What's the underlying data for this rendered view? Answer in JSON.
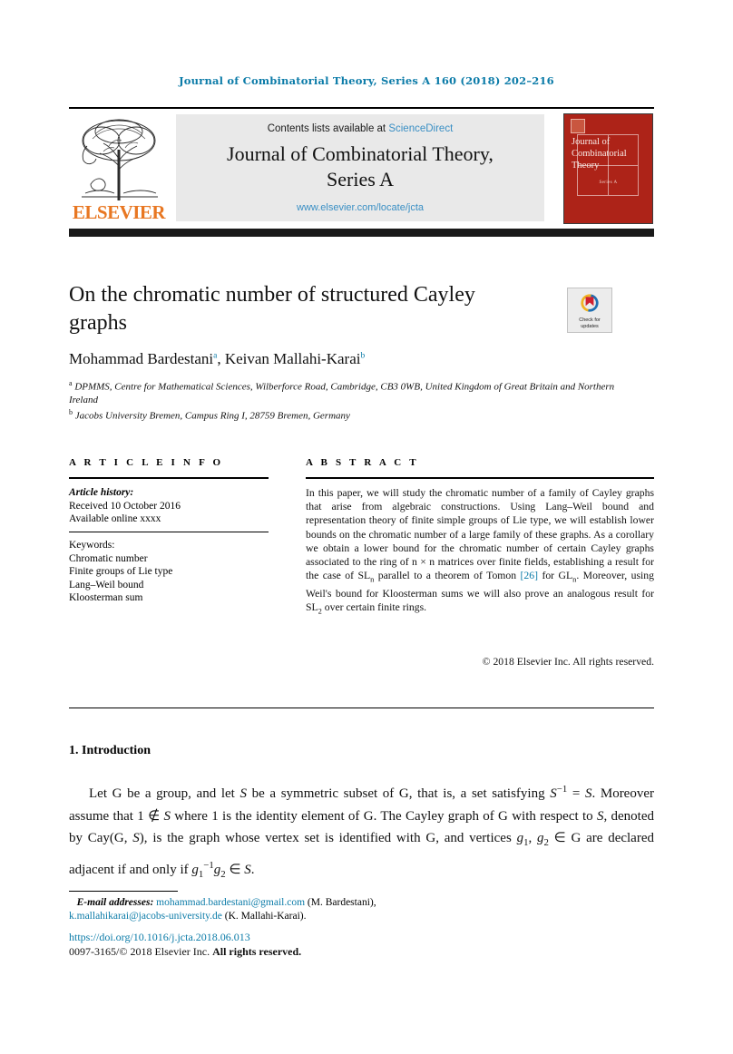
{
  "running_head": "Journal of Combinatorial Theory, Series A 160 (2018) 202–216",
  "masthead": {
    "contents_prefix": "Contents lists available at ",
    "sciencedirect": "ScienceDirect",
    "journal_title_line1": "Journal of Combinatorial Theory,",
    "journal_title_line2": "Series A",
    "journal_url": "www.elsevier.com/locate/jcta",
    "publisher_wordmark": "ELSEVIER",
    "cover": {
      "title": "Journal of Combinatorial Theory",
      "series": "Series A"
    },
    "colors": {
      "link": "#3a8fc4",
      "elsevier_orange": "#e87722",
      "cover_red": "#ad2318",
      "box_gray": "#e9e9e9"
    }
  },
  "article": {
    "title": "On the chromatic number of structured Cayley graphs",
    "authors": "Mohammad Bardestani, Keivan Mallahi-Karai",
    "author_list": [
      {
        "name": "Mohammad Bardestani",
        "marker": "a"
      },
      {
        "name": "Keivan Mallahi-Karai",
        "marker": "b"
      }
    ],
    "affiliations": [
      {
        "marker": "a",
        "text": "DPMMS, Centre for Mathematical Sciences, Wilberforce Road, Cambridge, CB3 0WB, United Kingdom of Great Britain and Northern Ireland"
      },
      {
        "marker": "b",
        "text": "Jacobs University Bremen, Campus Ring I, 28759 Bremen, Germany"
      }
    ],
    "crossmark_label_line1": "Check for",
    "crossmark_label_line2": "updates"
  },
  "info": {
    "heading": "A R T I C L E  I N F O",
    "history_label": "Article history:",
    "history": [
      "Received 10 October 2016",
      "Available online xxxx"
    ],
    "keywords_label": "Keywords:",
    "keywords": [
      "Chromatic number",
      "Finite groups of Lie type",
      "Lang–Weil bound",
      "Kloosterman sum"
    ]
  },
  "abstract": {
    "heading": "A B S T R A C T",
    "text_part1": "In this paper, we will study the chromatic number of a family of Cayley graphs that arise from algebraic constructions. Using Lang–Weil bound and representation theory of finite simple groups of Lie type, we will establish lower bounds on the chromatic number of a large family of these graphs. As a corollary we obtain a lower bound for the chromatic number of certain Cayley graphs associated to the ring of n × n matrices over finite fields, establishing a result for the case of SL",
    "sub1": "n",
    "text_part2": " parallel to a theorem of Tomon ",
    "citation": "[26]",
    "text_part3": " for GL",
    "sub2": "n",
    "text_part4": ". Moreover, using Weil's bound for Kloosterman sums we will also prove an analogous result for SL",
    "sub3": "2",
    "text_part5": " over certain finite rings.",
    "copyright": "© 2018 Elsevier Inc. All rights reserved."
  },
  "body": {
    "section_number_title": "1. Introduction",
    "paragraph_part1": "Let G be a group, and let ",
    "p_s1": "S",
    "paragraph_part2": " be a symmetric subset of G, that is, a set satisfying ",
    "p_s2": "S",
    "p_sup1": "−1",
    "paragraph_part3": " = ",
    "p_s3": "S",
    "paragraph_part4": ". Moreover assume that 1 ∉ ",
    "p_s4": "S",
    "paragraph_part5": " where 1 is the identity element of G. The Cayley graph of G with respect to ",
    "p_s5": "S",
    "paragraph_part6": ", denoted by Cay(G, ",
    "p_s6": "S",
    "paragraph_part7": "), is the graph whose vertex set is identified with G, and vertices ",
    "p_g1": "g",
    "p_g1sub": "1",
    "paragraph_part8": ", ",
    "p_g2": "g",
    "p_g2sub": "2",
    "paragraph_part9": " ∈ G are declared adjacent if and only if ",
    "p_g3": "g",
    "p_g3sub": "1",
    "p_g3sup": "−1",
    "p_g4": "g",
    "p_g4sub": "2",
    "paragraph_part10": " ∈ ",
    "p_s7": "S",
    "paragraph_part11": "."
  },
  "footer": {
    "email_label": "E-mail addresses:",
    "email1": "mohammad.bardestani@gmail.com",
    "email1_owner": "(M. Bardestani),",
    "email2": "k.mallahikarai@jacobs-university.de",
    "email2_owner": "(K. Mallahi-Karai).",
    "doi": "https://doi.org/10.1016/j.jcta.2018.06.013",
    "issn_prefix": "0097-3165/© 2018 Elsevier Inc.",
    "rights": "All rights reserved."
  }
}
